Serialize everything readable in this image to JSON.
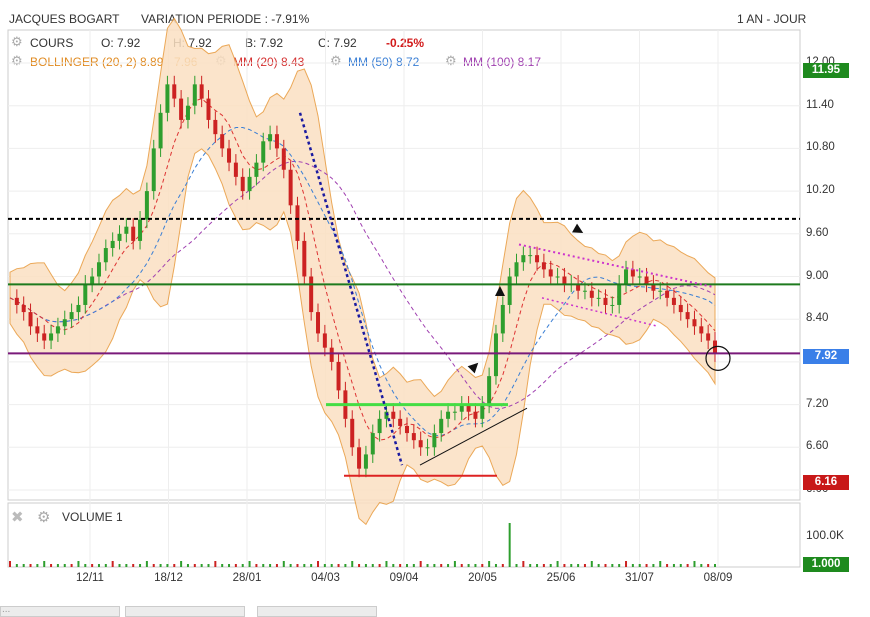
{
  "header": {
    "title": "JACQUES BOGART",
    "variation": "VARIATION PERIODE : -7.91%",
    "period": "1 AN - JOUR"
  },
  "legend": {
    "cours_label": "COURS",
    "open": "O: 7.92",
    "high": "H: 7.92",
    "low": "B: 7.92",
    "close": "C: 7.92",
    "change": "-0.25%",
    "bollinger": "BOLLINGER (20, 2)  8.89 - 7.96",
    "mm20": "MM (20)  8.43",
    "mm50": "MM (50)  8.72",
    "mm100": "MM (100)  8.17",
    "volume": "VOLUME  1"
  },
  "price_boxes": {
    "high": "11.95",
    "last": "7.92",
    "low": "6.16",
    "volume_last": "1.000"
  },
  "volume_tick": "100.0K",
  "colors": {
    "up": "#2e9e2e",
    "down": "#cc2222",
    "bollinger": "#e89a3c",
    "mm20": "#dd3333",
    "mm50": "#3a7fd5",
    "mm100": "#a040b0",
    "green_box": "#1e8a1e",
    "blue_box": "#3a7fe8",
    "red_box": "#c81818"
  },
  "footer": {
    "watermark": "..."
  },
  "chart_data": {
    "type": "candlestick",
    "title": "JACQUES BOGART",
    "x_tick_labels": [
      "12/11",
      "18/12",
      "28/01",
      "04/03",
      "09/04",
      "20/05",
      "25/06",
      "31/07",
      "08/09"
    ],
    "y_tick_labels": [
      "12.00",
      "11.40",
      "10.80",
      "10.20",
      "9.60",
      "9.00",
      "8.40",
      "7.80",
      "7.20",
      "6.60",
      "6.00"
    ],
    "ylim": [
      6.0,
      12.0
    ],
    "close_series": [
      8.7,
      8.6,
      8.5,
      8.3,
      8.2,
      8.1,
      8.2,
      8.3,
      8.4,
      8.5,
      8.6,
      8.9,
      9.0,
      9.2,
      9.4,
      9.5,
      9.6,
      9.7,
      9.5,
      9.8,
      10.2,
      10.8,
      11.3,
      11.7,
      11.5,
      11.2,
      11.4,
      11.7,
      11.5,
      11.2,
      11.0,
      10.8,
      10.6,
      10.4,
      10.2,
      10.4,
      10.6,
      10.9,
      11.0,
      10.8,
      10.5,
      10.0,
      9.5,
      9.0,
      8.5,
      8.2,
      8.0,
      7.8,
      7.4,
      7.0,
      6.6,
      6.3,
      6.5,
      6.8,
      7.0,
      7.1,
      7.0,
      6.9,
      6.8,
      6.7,
      6.6,
      6.6,
      6.8,
      7.0,
      7.1,
      7.1,
      7.2,
      7.1,
      7.0,
      7.2,
      7.6,
      8.2,
      8.6,
      9.0,
      9.2,
      9.3,
      9.3,
      9.2,
      9.1,
      9.0,
      9.0,
      8.9,
      8.9,
      8.8,
      8.8,
      8.7,
      8.7,
      8.6,
      8.6,
      8.9,
      9.1,
      9.0,
      9.0,
      8.9,
      8.8,
      8.8,
      8.7,
      8.6,
      8.5,
      8.4,
      8.3,
      8.2,
      8.1,
      7.92
    ],
    "horizontal_levels": [
      {
        "value": 9.81,
        "style": "dashed",
        "color": "#000000"
      },
      {
        "value": 8.89,
        "style": "solid",
        "color": "#1e7a1e"
      },
      {
        "value": 7.92,
        "style": "solid",
        "color": "#7a1a7a"
      },
      {
        "value": 7.2,
        "style": "solid",
        "color": "#44dd44"
      },
      {
        "value": 6.2,
        "style": "solid",
        "color": "#dd2222"
      }
    ],
    "volume_ytick": "100.0K",
    "grid": true
  }
}
